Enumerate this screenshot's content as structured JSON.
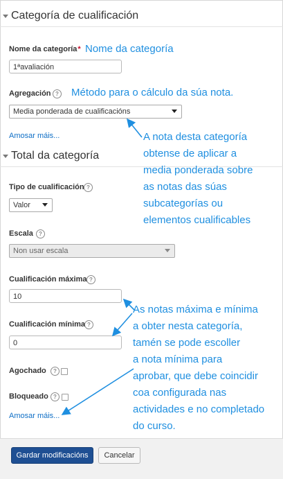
{
  "category_section": {
    "title": "Categoría de cualificación",
    "name_label": "Nome da categoría",
    "required_mark": "*",
    "name_value": "1ªavaliación",
    "aggregation_label": "Agregación",
    "aggregation_value": "Media ponderada de cualificacións",
    "show_more": "Amosar máis..."
  },
  "total_section": {
    "title": "Total da categoría",
    "grade_type_label": "Tipo de cualificación",
    "grade_type_value": "Valor",
    "scale_label": "Escala",
    "scale_value": "Non usar escala",
    "max_grade_label": "Cualificación máxima",
    "max_grade_value": "10",
    "min_grade_label": "Cualificación mínima",
    "min_grade_value": "0",
    "hidden_label": "Agochado",
    "locked_label": "Bloqueado",
    "show_more": "Amosar máis..."
  },
  "help_icon": "?",
  "buttons": {
    "save": "Gardar modificacións",
    "cancel": "Cancelar"
  },
  "annotations": {
    "name": "Nome da categoría",
    "method": "Método para o cálculo da súa nota.",
    "aggregation_lines": [
      "A nota desta categoría",
      "obtense de aplicar a",
      "media ponderada sobre",
      "as notas das súas",
      "subcategorías ou",
      "elementos cualificables"
    ],
    "grades_lines": [
      "As notas máxima e mínima",
      "a obter nesta categoría,",
      "tamén se pode escoller",
      "a nota mínima para",
      "aprobar, que debe coincidir",
      "coa configurada nas",
      "actividades e no completado",
      "do curso."
    ]
  },
  "colors": {
    "annotation": "#1f8fe0",
    "link": "#0f6fc6",
    "primary_button": "#1e4f93"
  }
}
